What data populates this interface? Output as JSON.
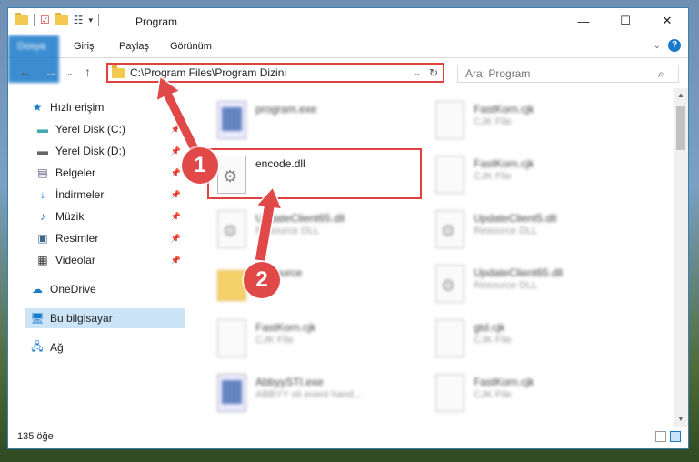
{
  "window": {
    "title": "Program",
    "controls": {
      "minimize": "—",
      "maximize": "☐",
      "close": "✕"
    }
  },
  "ribbon": {
    "tabs": [
      {
        "label": "Dosya",
        "active": true
      },
      {
        "label": "Giriş"
      },
      {
        "label": "Paylaş"
      },
      {
        "label": "Görünüm"
      }
    ],
    "help": "?"
  },
  "address": {
    "path": "C:\\Program Files\\Program Dizini",
    "search_placeholder": "Ara: Program"
  },
  "nav": {
    "items": [
      {
        "label": "Hızlı erişim",
        "icon": "star-icon",
        "pinned": false
      },
      {
        "label": "Yerel Disk (C:)",
        "icon": "disk-icon",
        "pinned": true
      },
      {
        "label": "Yerel Disk (D:)",
        "icon": "disk-icon",
        "pinned": true
      },
      {
        "label": "Belgeler",
        "icon": "documents-icon",
        "pinned": true
      },
      {
        "label": "İndirmeler",
        "icon": "download-icon",
        "pinned": true
      },
      {
        "label": "Müzik",
        "icon": "music-icon",
        "pinned": true
      },
      {
        "label": "Resimler",
        "icon": "pictures-icon",
        "pinned": true
      },
      {
        "label": "Videolar",
        "icon": "videos-icon",
        "pinned": true
      },
      {
        "label": "OneDrive",
        "icon": "cloud-icon",
        "pinned": false
      },
      {
        "label": "Bu bilgisayar",
        "icon": "computer-icon",
        "pinned": false,
        "selected": true
      },
      {
        "label": "Ağ",
        "icon": "network-icon",
        "pinned": false
      }
    ]
  },
  "files": [
    {
      "name": "program.exe",
      "type": "",
      "icon": "exe-icon"
    },
    {
      "name": "FastKorn.cjk",
      "type": "CJK File",
      "icon": "file-icon"
    },
    {
      "name": "encode.dll",
      "type": "",
      "icon": "dll-icon",
      "highlighted": true
    },
    {
      "name": "FastKorn.cjk",
      "type": "CJK File",
      "icon": "file-icon"
    },
    {
      "name": "UpdateClient65.dll",
      "type": "Resource DLL",
      "icon": "dll-icon"
    },
    {
      "name": "UpdateClient5.dll",
      "type": "Resource DLL",
      "icon": "dll-icon"
    },
    {
      "name": "Resource",
      "type": "",
      "icon": "folder-icon"
    },
    {
      "name": "UpdateClient65.dll",
      "type": "Resource DLL",
      "icon": "dll-icon"
    },
    {
      "name": "FastKorn.cjk",
      "type": "CJK File",
      "icon": "file-icon"
    },
    {
      "name": "gtd.cjk",
      "type": "CJK File",
      "icon": "file-icon"
    },
    {
      "name": "AbbyySTI.exe",
      "type": "ABBYY sti event hand...",
      "icon": "exe-icon"
    },
    {
      "name": "FastKorn.cjk",
      "type": "CJK File",
      "icon": "file-icon"
    }
  ],
  "status": {
    "count": "135 öğe"
  },
  "annotations": [
    {
      "label": "1",
      "color": "#e14848"
    },
    {
      "label": "2",
      "color": "#e14848"
    }
  ],
  "colors": {
    "accent": "#1979ca",
    "highlight": "#e04040",
    "selected_bg": "#cce4f7"
  }
}
